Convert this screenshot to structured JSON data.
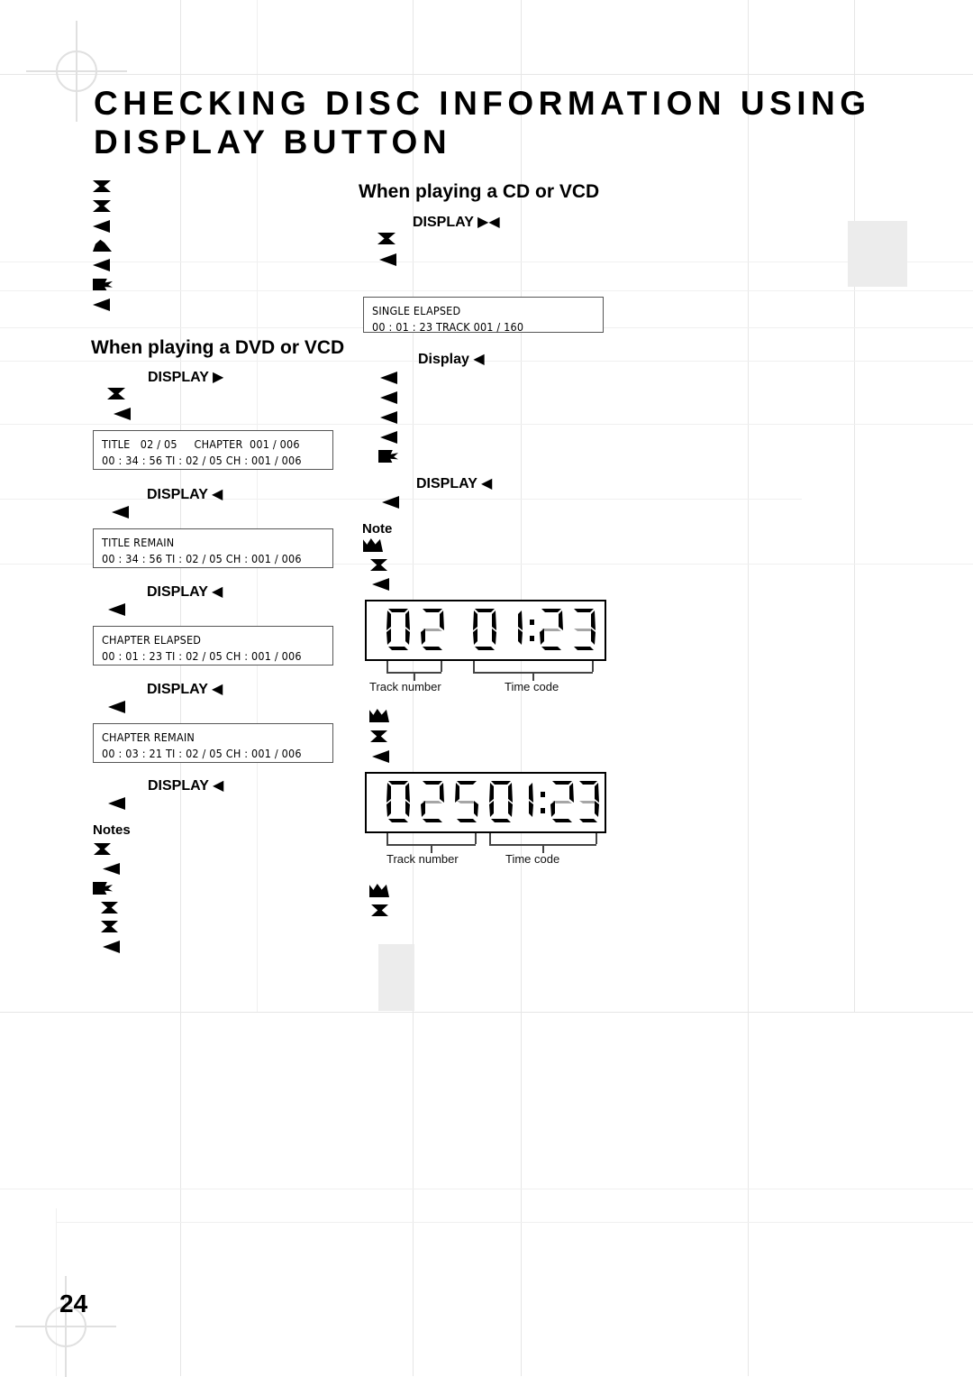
{
  "page": {
    "number": "24",
    "title_line1": "CHECKING DISC INFORMATION USING",
    "title_line2": "DISPLAY BUTTON"
  },
  "left_column": {
    "section_heading": "When playing a DVD or VCD",
    "steps": [
      {
        "label": "DISPLAY ▶"
      },
      {
        "label": "DISPLAY ◀"
      },
      {
        "label": "DISPLAY ◀"
      },
      {
        "label": "DISPLAY ◀"
      },
      {
        "label": "DISPLAY ◀"
      }
    ],
    "osd_boxes": [
      {
        "line1": "TITLE   02 / 05     CHAPTER  001 / 006",
        "line2": "00 : 34 : 56 TI : 02 / 05 CH : 001 / 006"
      },
      {
        "line1": "TITLE REMAIN",
        "line2": "00 : 34 : 56 TI : 02 / 05 CH : 001 / 006"
      },
      {
        "line1": "CHAPTER ELAPSED",
        "line2": "00 : 01 : 23 TI : 02 / 05 CH : 001 / 006"
      },
      {
        "line1": "CHAPTER REMAIN",
        "line2": "00 : 03 : 21 TI : 02 / 05 CH : 001 / 006"
      }
    ],
    "notes_label": "Notes"
  },
  "right_column": {
    "section_heading": "When playing a CD or VCD",
    "steps": [
      {
        "label": "DISPLAY ▶◀"
      },
      {
        "label": "Display ◀"
      },
      {
        "label": "DISPLAY ◀"
      }
    ],
    "osd_boxes": [
      {
        "line1": "SINGLE ELAPSED",
        "line2": "00 : 01 : 23 TRACK 001 / 160"
      }
    ],
    "note_label": "Note"
  },
  "lcd_displays": [
    {
      "track_digits": "02",
      "time_digits": "0123",
      "time_display": "01:23",
      "track_caption": "Track number",
      "time_caption": "Time code"
    },
    {
      "track_digits": "025",
      "time_digits": "0123",
      "time_display": "01:23",
      "track_caption": "Track number",
      "time_caption": "Time code"
    }
  ],
  "colors": {
    "ink": "#000000",
    "grid_line": "#f0f0f0",
    "grid_line_strong": "#e6e6e6",
    "gray_block": "#ececec",
    "osd_border": "#565656"
  }
}
